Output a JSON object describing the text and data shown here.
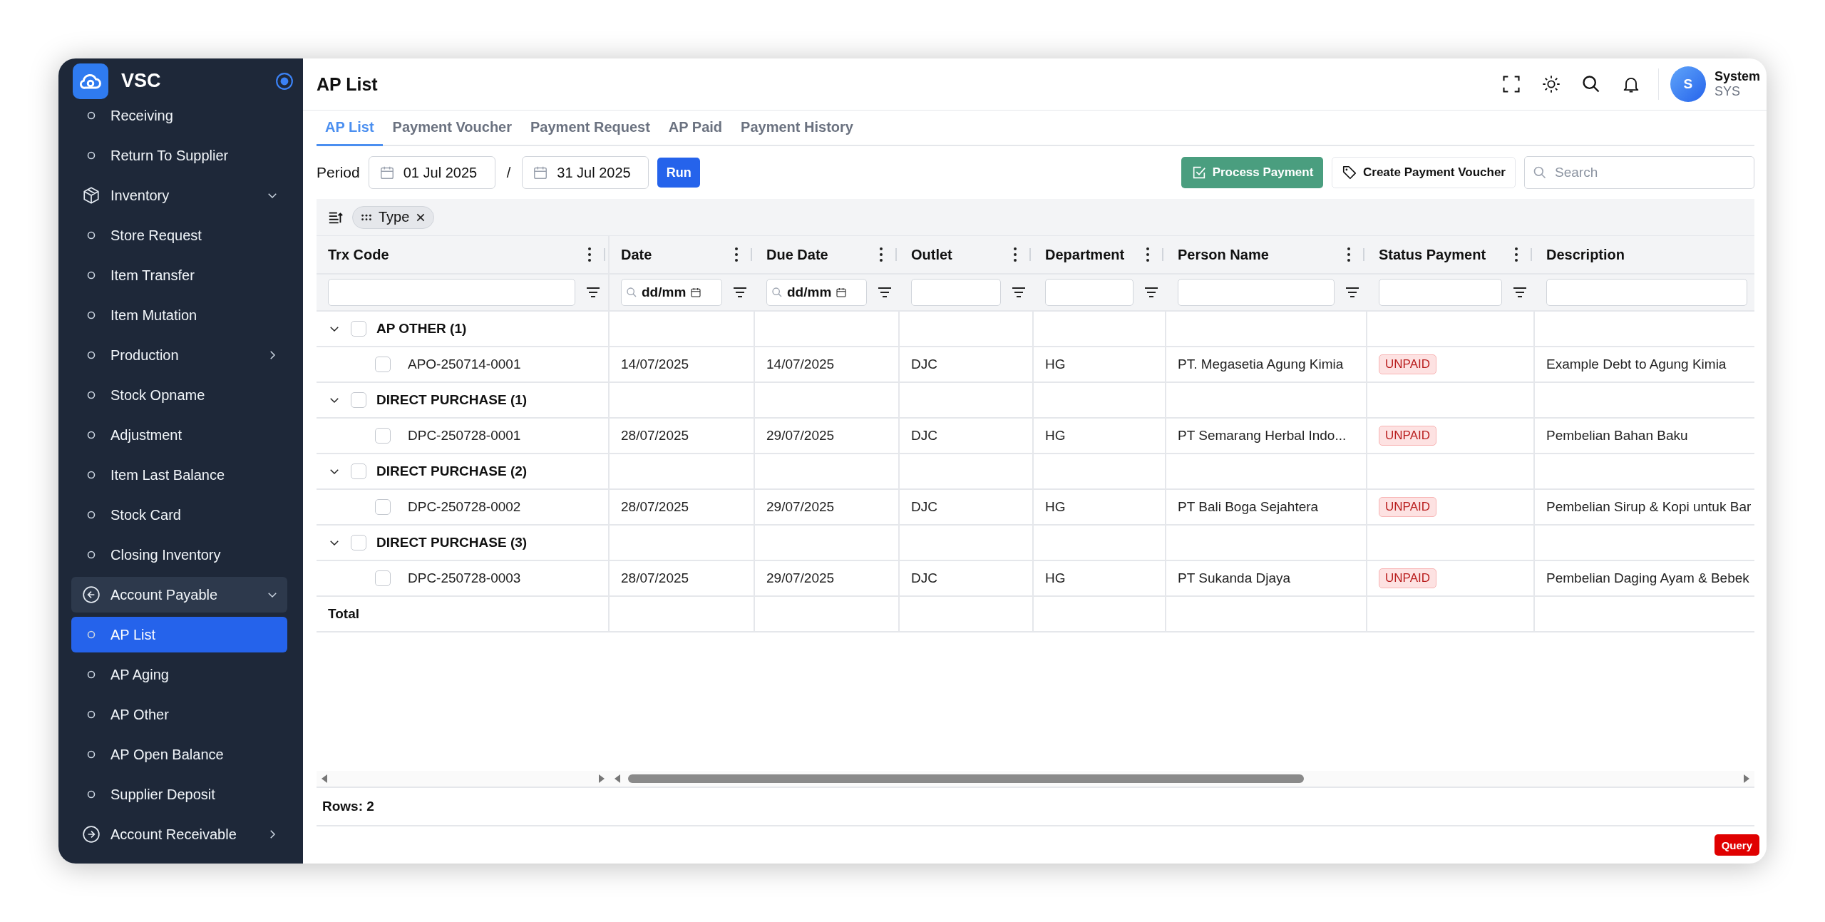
{
  "sidebar": {
    "brand": "VSC",
    "items": [
      {
        "label": "Receiving",
        "kind": "page",
        "selected": false
      },
      {
        "label": "Return To Supplier",
        "kind": "page",
        "selected": false
      },
      {
        "label": "Inventory",
        "kind": "module",
        "selected": false,
        "expanded": true,
        "highlighted": false,
        "children": [
          {
            "label": "Store Request",
            "kind": "page",
            "selected": false
          },
          {
            "label": "Item Transfer",
            "kind": "page",
            "selected": false
          },
          {
            "label": "Item Mutation",
            "kind": "page",
            "selected": false
          },
          {
            "label": "Production",
            "kind": "page",
            "selected": false,
            "expanded": false,
            "highlighted": false
          },
          {
            "label": "Stock Opname",
            "kind": "page",
            "selected": false
          },
          {
            "label": "Adjustment",
            "kind": "page",
            "selected": false
          },
          {
            "label": "Item Last Balance",
            "kind": "page",
            "selected": false
          },
          {
            "label": "Stock Card",
            "kind": "page",
            "selected": false
          },
          {
            "label": "Closing Inventory",
            "kind": "page",
            "selected": false
          }
        ]
      },
      {
        "label": "Account Payable",
        "kind": "module",
        "selected": false,
        "expanded": true,
        "highlighted": true,
        "children": [
          {
            "label": "AP List",
            "kind": "page",
            "selected": true
          },
          {
            "label": "AP Aging",
            "kind": "page",
            "selected": false
          },
          {
            "label": "AP Other",
            "kind": "page",
            "selected": false
          },
          {
            "label": "AP Open Balance",
            "kind": "page",
            "selected": false
          },
          {
            "label": "Supplier Deposit",
            "kind": "page",
            "selected": false
          }
        ]
      },
      {
        "label": "Account Receivable",
        "kind": "module",
        "selected": false,
        "expanded": false,
        "highlighted": false
      }
    ]
  },
  "header": {
    "title": "AP List",
    "user": {
      "initial": "S",
      "name": "System",
      "role": "SYS"
    }
  },
  "tabs": [
    {
      "label": "AP List",
      "selected": true
    },
    {
      "label": "Payment Voucher",
      "selected": false
    },
    {
      "label": "Payment Request",
      "selected": false
    },
    {
      "label": "AP Paid",
      "selected": false
    },
    {
      "label": "Payment History",
      "selected": false
    }
  ],
  "toolbar": {
    "period_label": "Period",
    "start_date": "01 Jul 2025",
    "separator": "/",
    "end_date": "31 Jul 2025",
    "run_button": "Run",
    "process_button": "Process Payment",
    "voucher_button": "Create Payment Voucher",
    "search": {
      "placeholder": "Search"
    }
  },
  "grouping": {
    "chips": [
      {
        "label": "Type"
      }
    ]
  },
  "table": {
    "columns": [
      {
        "label": "Trx Code",
        "kind": "text",
        "filter": {
          "kind": "text"
        },
        "menu": true,
        "filter_button": true
      },
      {
        "label": "Date",
        "kind": "text",
        "filter": {
          "kind": "date",
          "placeholder": "dd/mm"
        },
        "menu": true,
        "filter_button": true
      },
      {
        "label": "Due Date",
        "kind": "text",
        "filter": {
          "kind": "date",
          "placeholder": "dd/mm"
        },
        "menu": true,
        "filter_button": true
      },
      {
        "label": "Outlet",
        "kind": "text",
        "filter": {
          "kind": "text"
        },
        "menu": true,
        "filter_button": true
      },
      {
        "label": "Department",
        "kind": "text",
        "filter": {
          "kind": "text"
        },
        "menu": true,
        "filter_button": true
      },
      {
        "label": "Person Name",
        "kind": "text",
        "filter": {
          "kind": "text"
        },
        "menu": true,
        "filter_button": true
      },
      {
        "label": "Status Payment",
        "kind": "badge",
        "filter": {
          "kind": "text"
        },
        "menu": true,
        "filter_button": true
      },
      {
        "label": "Description",
        "kind": "text",
        "filter": {
          "kind": "text"
        },
        "menu": false,
        "filter_button": false
      }
    ],
    "groups": [
      {
        "label": "AP OTHER (1)",
        "expanded": true,
        "checked": false,
        "children": [
          {
            "checked": false,
            "cells": [
              "APO-250714-0001",
              "14/07/2025",
              "14/07/2025",
              "DJC",
              "HG",
              "PT. Megasetia Agung Kimia",
              "UNPAID",
              "Example Debt to Agung Kimia"
            ]
          }
        ]
      },
      {
        "label": "DIRECT PURCHASE (1)",
        "expanded": true,
        "checked": false,
        "children": [
          {
            "checked": false,
            "cells": [
              "DPC-250728-0001",
              "28/07/2025",
              "29/07/2025",
              "DJC",
              "HG",
              "PT Semarang Herbal Indo...",
              "UNPAID",
              "Pembelian Bahan Baku"
            ]
          }
        ]
      },
      {
        "label": "DIRECT PURCHASE (2)",
        "expanded": true,
        "checked": false,
        "children": [
          {
            "checked": false,
            "cells": [
              "DPC-250728-0002",
              "28/07/2025",
              "29/07/2025",
              "DJC",
              "HG",
              "PT Bali Boga Sejahtera",
              "UNPAID",
              "Pembelian Sirup & Kopi untuk Bar"
            ]
          }
        ]
      },
      {
        "label": "DIRECT PURCHASE (3)",
        "expanded": true,
        "checked": false,
        "children": [
          {
            "checked": false,
            "cells": [
              "DPC-250728-0003",
              "28/07/2025",
              "29/07/2025",
              "DJC",
              "HG",
              "PT Sukanda Djaya",
              "UNPAID",
              "Pembelian Daging Ayam & Bebek"
            ]
          }
        ]
      }
    ],
    "total_label": "Total"
  },
  "footer": {
    "rows_count": "Rows: 2",
    "query_button": "Query"
  }
}
